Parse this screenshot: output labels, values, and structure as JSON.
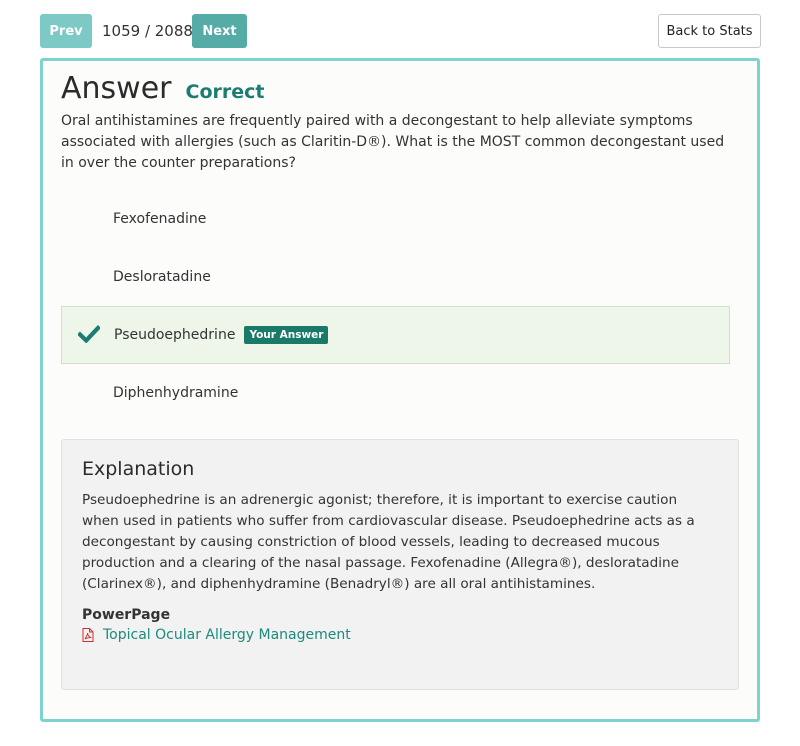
{
  "nav": {
    "prev_label": "Prev",
    "counter": "1059 / 2088",
    "next_label": "Next",
    "back_label": "Back to Stats"
  },
  "answer": {
    "title": "Answer",
    "status": "Correct"
  },
  "question": "Oral antihistamines are frequently paired with a decongestant to help alleviate symptoms associated with allergies (such as Claritin-D®). What is the MOST common decongestant used in over the counter preparations?",
  "options": [
    {
      "label": "Fexofenadine",
      "selected": false
    },
    {
      "label": "Desloratadine",
      "selected": false
    },
    {
      "label": "Pseudoephedrine",
      "selected": true,
      "badge": "Your Answer"
    },
    {
      "label": "Diphenhydramine",
      "selected": false
    }
  ],
  "explanation": {
    "title": "Explanation",
    "text": "Pseudoephedrine is an adrenergic agonist; therefore, it is important to exercise caution when used in patients who suffer from cardiovascular disease. Pseudoephedrine acts as a decongestant by causing constriction of blood vessels, leading to decreased mucous production and a clearing of the nasal passage. Fexofenadine (Allegra®), desloratadine (Clarinex®), and diphenhydramine (Benadryl®) are all oral antihistamines.",
    "powerpage_label": "PowerPage",
    "powerpage_link": "Topical Ocular Allergy Management"
  },
  "colors": {
    "accent": "#7fd3cf",
    "correct": "#1c7c72",
    "selected_bg": "#eef6ea",
    "link": "#1c8a7e",
    "pdf_icon": "#c9302c"
  },
  "icons": {
    "check": "checkmark-icon",
    "pdf": "pdf-file-icon"
  }
}
